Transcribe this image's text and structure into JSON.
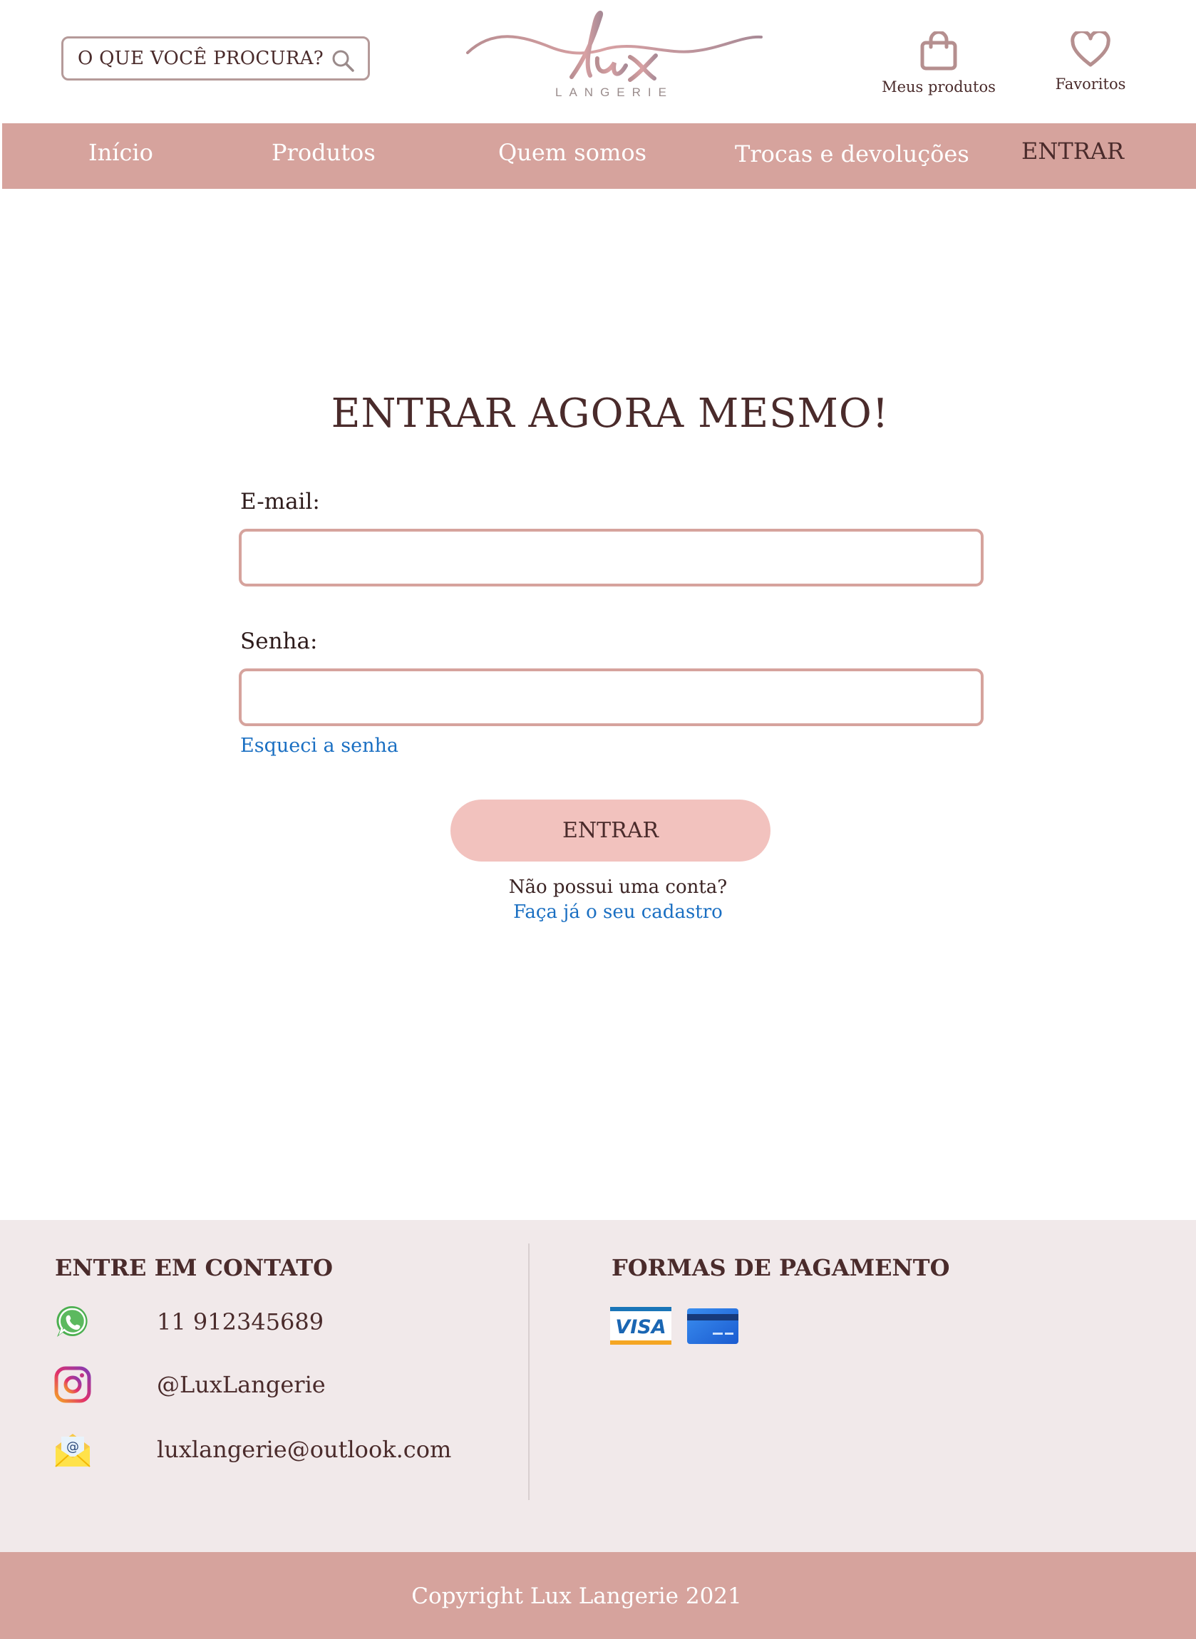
{
  "header": {
    "search": {
      "label": "O QUE VOCÊ PROCURA?",
      "icon": "search-icon"
    },
    "logo": {
      "script_text": "lux",
      "subtitle": "LANGERIE"
    },
    "my_products": {
      "label": "Meus produtos",
      "icon": "shopping-bag-icon"
    },
    "favorites": {
      "label": "Favoritos",
      "icon": "heart-icon"
    }
  },
  "nav": {
    "items": [
      {
        "label": "Início"
      },
      {
        "label": "Produtos"
      },
      {
        "label": "Quem somos"
      },
      {
        "label": "Trocas e devoluções"
      }
    ],
    "login_label": "ENTRAR"
  },
  "login": {
    "title": "ENTRAR AGORA MESMO!",
    "email_label": "E-mail:",
    "email_value": "",
    "password_label": "Senha:",
    "password_value": "",
    "forgot_link": "Esqueci a senha",
    "submit_label": "ENTRAR",
    "no_account_text": "Não possui uma conta?",
    "signup_link": "Faça já o seu cadastro"
  },
  "footer": {
    "contact_heading": "ENTRE EM CONTATO",
    "contacts": [
      {
        "icon": "whatsapp-icon",
        "text": "11 912345689"
      },
      {
        "icon": "instagram-icon",
        "text": "@LuxLangerie"
      },
      {
        "icon": "email-icon",
        "text": "luxlangerie@outlook.com"
      }
    ],
    "payment_heading": "FORMAS DE PAGAMENTO",
    "payment_methods": [
      {
        "icon": "visa-card-icon",
        "text": "VISA"
      },
      {
        "icon": "credit-card-icon"
      }
    ],
    "copyright": "Copyright Lux Langerie 2021"
  },
  "colors": {
    "brand_pink": "#d6a39d",
    "button_pink": "#f2c2be",
    "text_brown": "#4a2b2b",
    "link_blue": "#1a6fc2",
    "footer_bg": "#f1e9ea"
  }
}
